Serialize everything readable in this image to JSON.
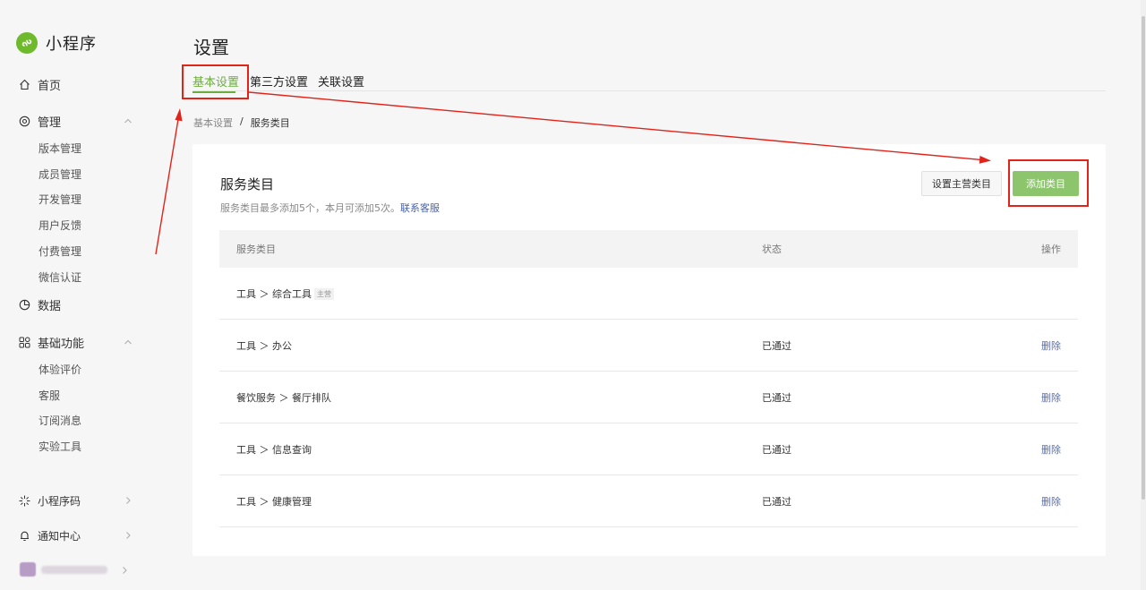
{
  "app": {
    "title": "小程序"
  },
  "sidebar": {
    "home": "首页",
    "manage": {
      "label": "管理",
      "items": [
        "版本管理",
        "成员管理",
        "开发管理",
        "用户反馈",
        "付费管理",
        "微信认证"
      ]
    },
    "data": "数据",
    "basic": {
      "label": "基础功能",
      "items": [
        "体验评价",
        "客服",
        "订阅消息",
        "实验工具"
      ]
    },
    "qrcode": "小程序码",
    "notice": "通知中心"
  },
  "page": {
    "title": "设置",
    "tabs": [
      "基本设置",
      "第三方设置",
      "关联设置"
    ],
    "active_tab": 0,
    "breadcrumb": {
      "parent": "基本设置",
      "separator": "/",
      "current": "服务类目"
    }
  },
  "card": {
    "title": "服务类目",
    "desc_prefix": "服务类目最多添加5个，本月可添加5次。",
    "desc_link": "联系客服",
    "btn_set_main": "设置主营类目",
    "btn_add": "添加类目"
  },
  "table": {
    "headers": [
      "服务类目",
      "状态",
      "操作"
    ],
    "rows": [
      {
        "category": "工具 ＞ 综合工具",
        "tag": "主营",
        "status": "",
        "action": ""
      },
      {
        "category": "工具 ＞ 办公",
        "tag": "",
        "status": "已通过",
        "action": "删除"
      },
      {
        "category": "餐饮服务 ＞ 餐厅排队",
        "tag": "",
        "status": "已通过",
        "action": "删除"
      },
      {
        "category": "工具 ＞ 信息查询",
        "tag": "",
        "status": "已通过",
        "action": "删除"
      },
      {
        "category": "工具 ＞ 健康管理",
        "tag": "",
        "status": "已通过",
        "action": "删除"
      }
    ]
  },
  "colors": {
    "accent": "#6cae3e",
    "primary_button": "#8cc56c",
    "annotation": "#e2231a",
    "link": "#4a62a8"
  }
}
